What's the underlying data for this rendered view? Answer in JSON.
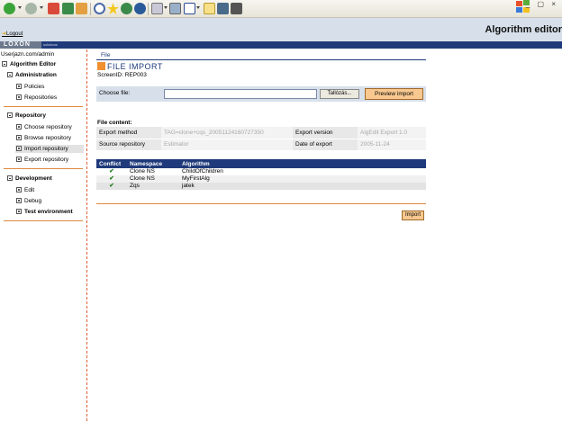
{
  "browser": {
    "icons": [
      "back-icon",
      "forward-icon",
      "stop-icon",
      "refresh-icon",
      "home-icon",
      "search-icon",
      "favorites-icon",
      "media-icon",
      "history-icon",
      "mail-icon",
      "print-icon",
      "edit-icon",
      "folder-icon",
      "messenger-icon"
    ],
    "window_controls": "_ ▢ ×"
  },
  "header": {
    "logout": "Logout",
    "app_title": "Algorithm editor",
    "brand": "LOXON",
    "brand_sub": "solutions"
  },
  "sidebar": {
    "user": "Userjazn.com/admin",
    "root": "Algorithm Editor",
    "administration": {
      "label": "Administration",
      "items": [
        "Policies",
        "Repositories"
      ]
    },
    "repository": {
      "label": "Repository",
      "items": [
        "Choose repository",
        "Browse repository",
        "Import repository",
        "Export repository"
      ]
    },
    "development": {
      "label": "Development",
      "items": [
        "Edit",
        "Debug",
        "Test environment"
      ]
    }
  },
  "main": {
    "menu_file": "File",
    "title": "FILE IMPORT",
    "screen_id": "ScreenID: REP003",
    "choose_label": "Choose file:",
    "file_value": "",
    "browse_label": "Tallózás...",
    "preview_label": "Preview import",
    "file_content_label": "File content:",
    "content": {
      "export_method_label": "Export method",
      "export_method_value": "TAG=clone+cqs_20051124160727350",
      "export_version_label": "Export version",
      "export_version_value": "AlgEdit Export 1.0",
      "source_repository_label": "Source repository",
      "source_repository_value": "Estimator",
      "date_of_export_label": "Date of export",
      "date_of_export_value": "2005-11-24"
    },
    "table": {
      "headers": [
        "Conflict",
        "Namespace",
        "Algorithm"
      ],
      "rows": [
        {
          "conflict": "✔",
          "namespace": "Clone NS",
          "algorithm": "ChildOfChildren"
        },
        {
          "conflict": "✔",
          "namespace": "Clone NS",
          "algorithm": "MyFirstAlg"
        },
        {
          "conflict": "✔",
          "namespace": "Zqs",
          "algorithm": "jatek"
        }
      ]
    },
    "import_label": "Import"
  },
  "colors": {
    "accent_navy": "#1f3a7a",
    "accent_orange": "#f09030",
    "panel_blue": "#d7e0ea",
    "button_orange": "#f8c890"
  }
}
